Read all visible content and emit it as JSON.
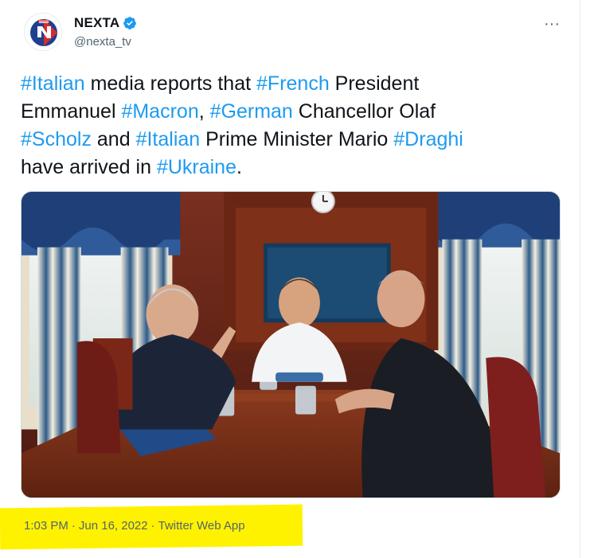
{
  "author": {
    "display_name": "NEXTA",
    "handle": "@nexta_tv",
    "verified": true,
    "avatar_icon": "nexta-logo-icon"
  },
  "more_icon": "more-options-icon",
  "tweet": {
    "line1": {
      "hashtag1": "#Italian",
      "text1": " media reports that ",
      "hashtag2": "#French",
      "text2": " President"
    },
    "line2": {
      "text1": "Emmanuel ",
      "hashtag1": "#Macron",
      "text2": ", ",
      "hashtag2": "#German",
      "text3": " Chancellor Olaf"
    },
    "line3": {
      "hashtag1": "#Scholz",
      "text1": " and ",
      "hashtag2": "#Italian",
      "text2": " Prime Minister Mario ",
      "hashtag3": "#Draghi"
    },
    "line4": {
      "text1": "have arrived in ",
      "hashtag1": "#Ukraine",
      "text2": "."
    }
  },
  "media": {
    "type": "photo"
  },
  "meta": {
    "time": "1:03 PM",
    "separator1": "·",
    "date": "Jun 16, 2022",
    "separator2": "·",
    "source": "Twitter Web App"
  },
  "colors": {
    "hashtag": "#1d9bf0",
    "text": "#0f1419",
    "secondary": "#536471",
    "highlight": "#fff200"
  }
}
